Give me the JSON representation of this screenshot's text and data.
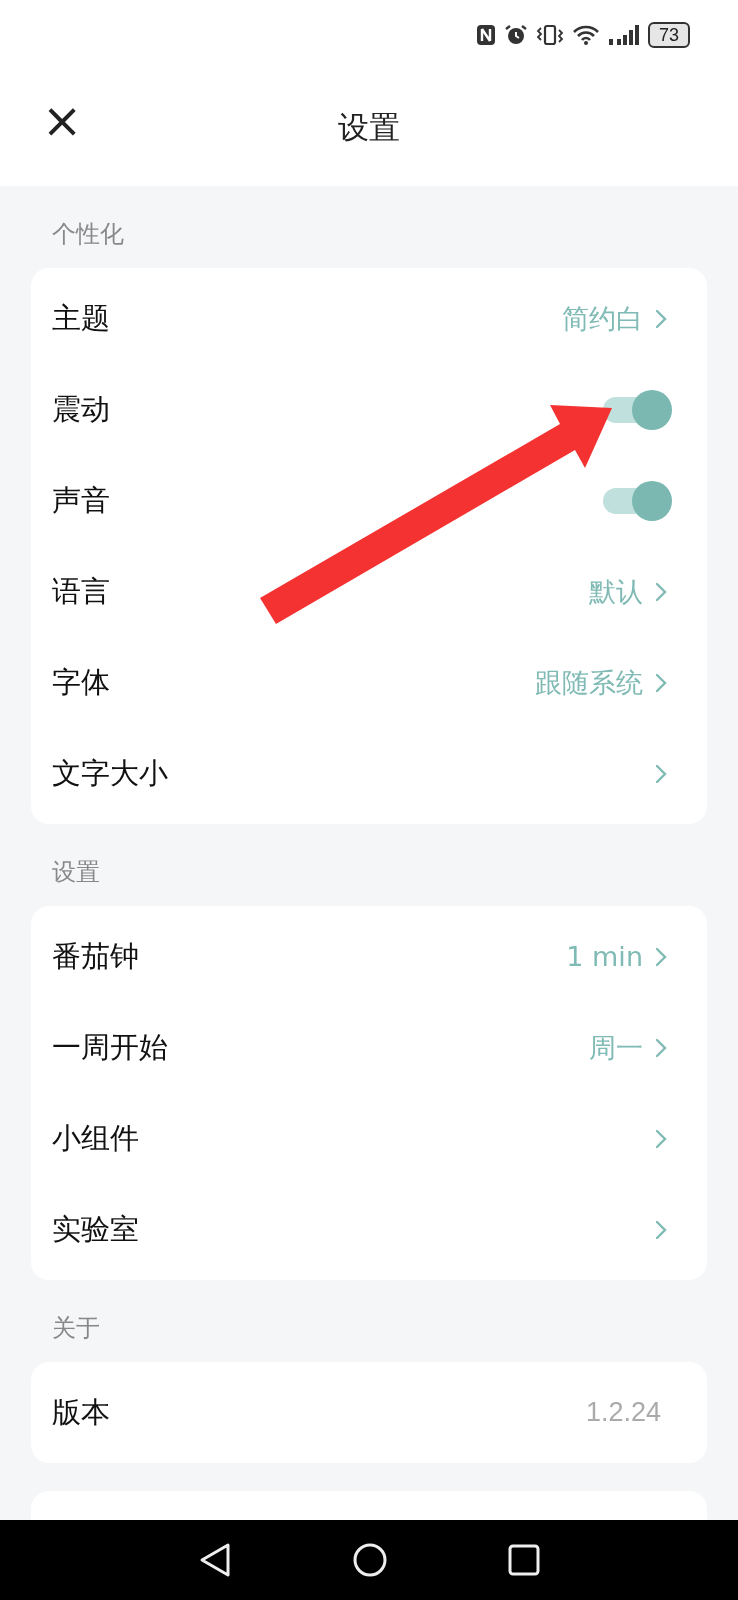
{
  "status_bar": {
    "battery": "73"
  },
  "header": {
    "close": "×",
    "title": "设置"
  },
  "sections": [
    {
      "title": "个性化",
      "rows": [
        {
          "kind": "link",
          "label": "主题",
          "value": "简约白"
        },
        {
          "kind": "toggle",
          "label": "震动",
          "on": true
        },
        {
          "kind": "toggle",
          "label": "声音",
          "on": true
        },
        {
          "kind": "link",
          "label": "语言",
          "value": "默认"
        },
        {
          "kind": "link",
          "label": "字体",
          "value": "跟随系统"
        },
        {
          "kind": "link",
          "label": "文字大小"
        }
      ]
    },
    {
      "title": "设置",
      "rows": [
        {
          "kind": "link",
          "label": "番茄钟",
          "value": "1 min"
        },
        {
          "kind": "link",
          "label": "一周开始",
          "value": "周一"
        },
        {
          "kind": "link",
          "label": "小组件"
        },
        {
          "kind": "link",
          "label": "实验室"
        }
      ]
    },
    {
      "title": "关于",
      "rows": [
        {
          "kind": "text",
          "label": "版本",
          "value": "1.2.24"
        }
      ]
    }
  ]
}
